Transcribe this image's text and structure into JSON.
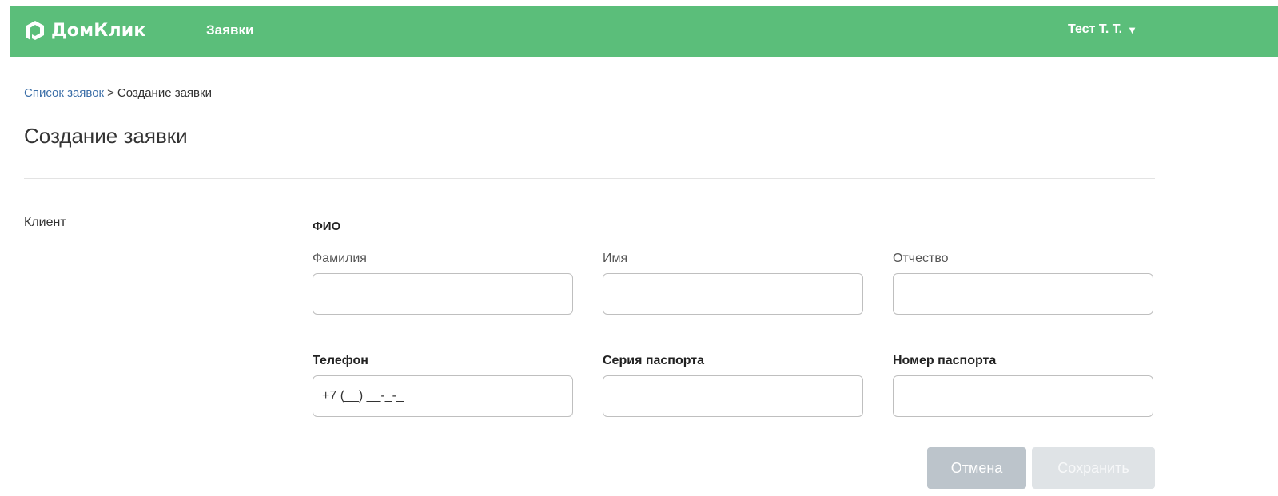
{
  "header": {
    "logo_text": "ДомКлик",
    "nav_requests": "Заявки",
    "user_name": "Тест Т. Т.",
    "user_caret": "▼",
    "brand_color": "#5bbe7a"
  },
  "breadcrumb": {
    "link": "Список заявок",
    "separator": ">",
    "current": "Создание заявки"
  },
  "page": {
    "title": "Создание заявки"
  },
  "form": {
    "section_label": "Клиент",
    "fio_title": "ФИО",
    "fields": {
      "last_name": {
        "label": "Фамилия",
        "value": ""
      },
      "first_name": {
        "label": "Имя",
        "value": ""
      },
      "middle_name": {
        "label": "Отчество",
        "value": ""
      },
      "phone": {
        "label": "Телефон",
        "placeholder": "+7 (__) __-_-_",
        "value": ""
      },
      "passport_series": {
        "label": "Серия паспорта",
        "value": ""
      },
      "passport_number": {
        "label": "Номер паспорта",
        "value": ""
      }
    }
  },
  "actions": {
    "cancel_label": "Отмена",
    "save_label": "Сохранить"
  },
  "icons": {
    "logo": "domclick-logo-icon",
    "caret": "chevron-down-icon"
  }
}
